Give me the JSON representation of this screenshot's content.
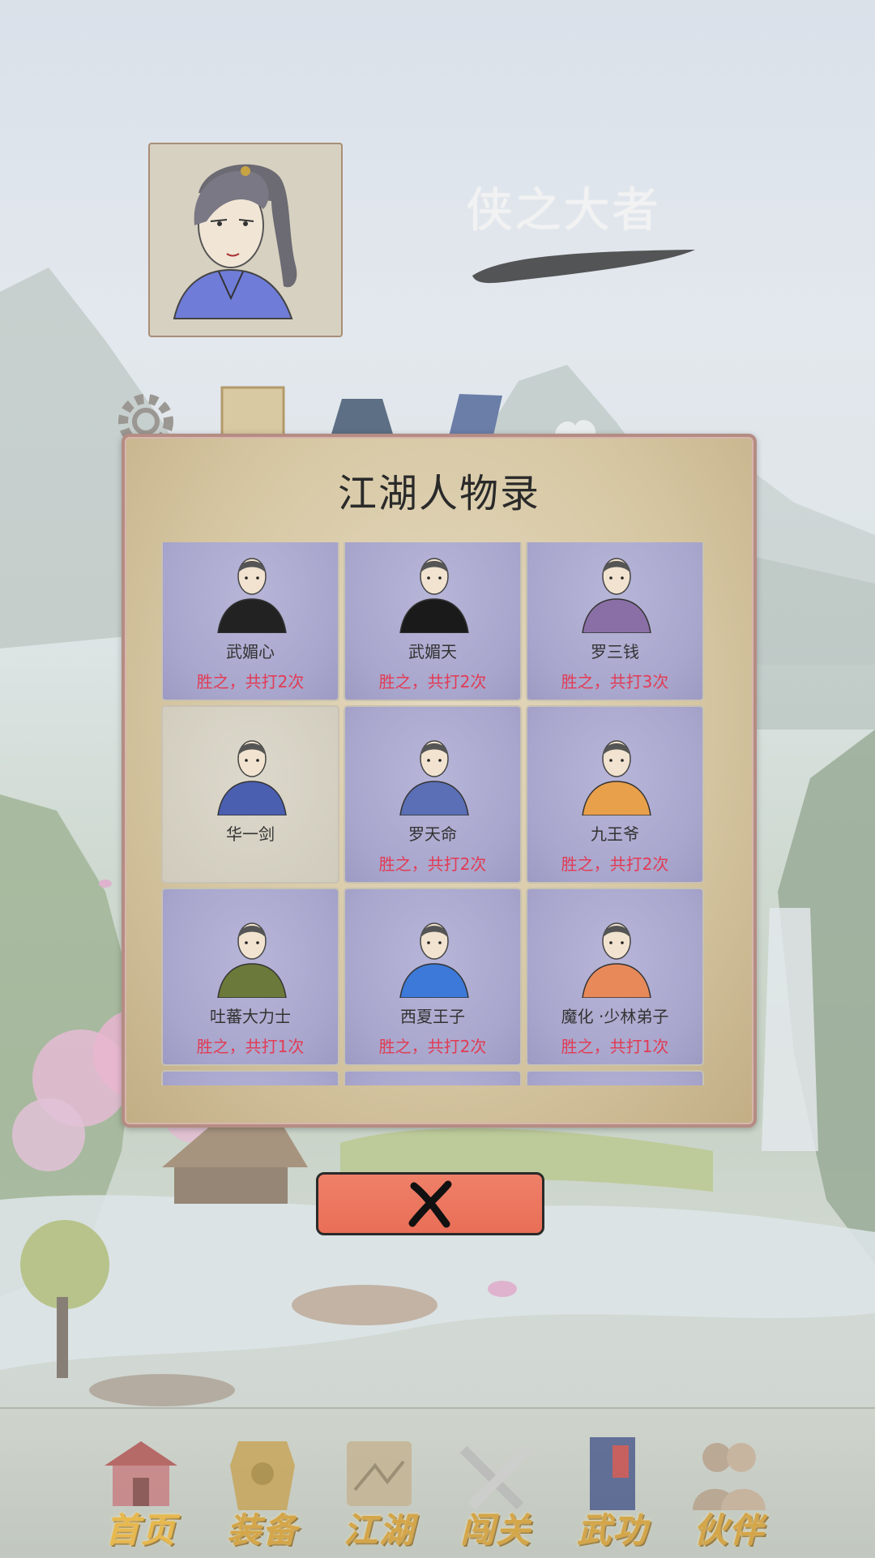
{
  "header": {
    "player_name": "侠之大者"
  },
  "top_icons": [
    "gear-icon",
    "scroll-icon",
    "pouch-icon",
    "card-icon",
    "cloud-icon"
  ],
  "modal": {
    "title": "江湖人物录",
    "characters": [
      {
        "name": "武媚心",
        "record": "胜之，共打2次",
        "defeated": true,
        "robe": "#222222"
      },
      {
        "name": "武媚天",
        "record": "胜之，共打2次",
        "defeated": true,
        "robe": "#1a1a1a"
      },
      {
        "name": "罗三钱",
        "record": "胜之，共打3次",
        "defeated": true,
        "robe": "#8a6fa6"
      },
      {
        "name": "华一剑",
        "record": "",
        "defeated": false,
        "robe": "#4a5fb0"
      },
      {
        "name": "罗天命",
        "record": "胜之，共打2次",
        "defeated": true,
        "robe": "#5a6fb5"
      },
      {
        "name": "九王爷",
        "record": "胜之，共打2次",
        "defeated": true,
        "robe": "#e9a04a"
      },
      {
        "name": "吐蕃大力士",
        "record": "胜之，共打1次",
        "defeated": true,
        "robe": "#6b7a3a"
      },
      {
        "name": "西夏王子",
        "record": "胜之，共打2次",
        "defeated": true,
        "robe": "#3c79d8"
      },
      {
        "name": "魔化 ·少林弟子",
        "record": "胜之，共打1次",
        "defeated": true,
        "robe": "#e8895a"
      },
      {
        "name": "",
        "record": "",
        "defeated": true,
        "robe": "#777777"
      },
      {
        "name": "",
        "record": "",
        "defeated": true,
        "robe": "#555555"
      },
      {
        "name": "",
        "record": "",
        "defeated": true,
        "robe": "#333333"
      }
    ],
    "close_icon": "close-icon"
  },
  "bottom_nav": [
    {
      "label": "首页",
      "icon": "home-icon",
      "active": true
    },
    {
      "label": "装备",
      "icon": "armor-icon",
      "active": false
    },
    {
      "label": "江湖",
      "icon": "map-icon",
      "active": false
    },
    {
      "label": "闯关",
      "icon": "swords-icon",
      "active": false
    },
    {
      "label": "武功",
      "icon": "book-icon",
      "active": false
    },
    {
      "label": "伙伴",
      "icon": "partners-icon",
      "active": false
    }
  ],
  "colors": {
    "record_text": "#e23b55",
    "close_button": "#ea7158",
    "nav_label": "#d4a64a"
  }
}
